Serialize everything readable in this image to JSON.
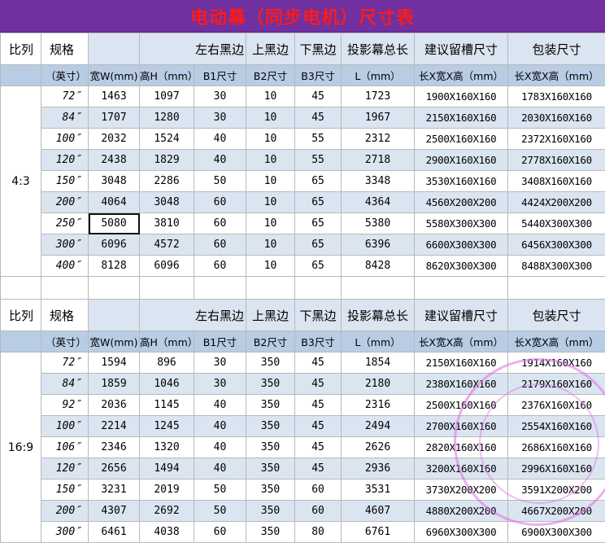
{
  "title": "电动幕（同步电机）尺寸表",
  "header_top": [
    "比列",
    "规格",
    "",
    "左右黑边",
    "上黑边",
    "下黑边",
    "投影幕总长",
    "建议留槽尺寸",
    "包装尺寸"
  ],
  "header_sub": [
    "",
    "（英寸）",
    "宽W(mm)",
    "高H（mm）",
    "B1尺寸",
    "B2尺寸",
    "B3尺寸",
    "L（mm）",
    "长X宽X高（mm）",
    "长X宽X高（mm）"
  ],
  "sections": [
    {
      "ratio": "4:3",
      "rows": [
        {
          "size": "72″",
          "w": "1463",
          "h": "1097",
          "b1": "30",
          "b2": "10",
          "b3": "45",
          "l": "1723",
          "slot": "1900X160X160",
          "pack": "1783X160X160"
        },
        {
          "size": "84″",
          "w": "1707",
          "h": "1280",
          "b1": "30",
          "b2": "10",
          "b3": "45",
          "l": "1967",
          "slot": "2150X160X160",
          "pack": "2030X160X160"
        },
        {
          "size": "100″",
          "w": "2032",
          "h": "1524",
          "b1": "40",
          "b2": "10",
          "b3": "55",
          "l": "2312",
          "slot": "2500X160X160",
          "pack": "2372X160X160"
        },
        {
          "size": "120″",
          "w": "2438",
          "h": "1829",
          "b1": "40",
          "b2": "10",
          "b3": "55",
          "l": "2718",
          "slot": "2900X160X160",
          "pack": "2778X160X160"
        },
        {
          "size": "150″",
          "w": "3048",
          "h": "2286",
          "b1": "50",
          "b2": "10",
          "b3": "65",
          "l": "3348",
          "slot": "3530X160X160",
          "pack": "3408X160X160"
        },
        {
          "size": "200″",
          "w": "4064",
          "h": "3048",
          "b1": "60",
          "b2": "10",
          "b3": "65",
          "l": "4364",
          "slot": "4560X200X200",
          "pack": "4424X200X200"
        },
        {
          "size": "250″",
          "w": "5080",
          "h": "3810",
          "b1": "60",
          "b2": "10",
          "b3": "65",
          "l": "5380",
          "slot": "5580X300X300",
          "pack": "5440X300X300"
        },
        {
          "size": "300″",
          "w": "6096",
          "h": "4572",
          "b1": "60",
          "b2": "10",
          "b3": "65",
          "l": "6396",
          "slot": "6600X300X300",
          "pack": "6456X300X300"
        },
        {
          "size": "400″",
          "w": "8128",
          "h": "6096",
          "b1": "60",
          "b2": "10",
          "b3": "65",
          "l": "8428",
          "slot": "8620X300X300",
          "pack": "8488X300X300"
        }
      ]
    },
    {
      "ratio": "16:9",
      "rows": [
        {
          "size": "72″",
          "w": "1594",
          "h": "896",
          "b1": "30",
          "b2": "350",
          "b3": "45",
          "l": "1854",
          "slot": "2150X160X160",
          "pack": "1914X160X160"
        },
        {
          "size": "84″",
          "w": "1859",
          "h": "1046",
          "b1": "30",
          "b2": "350",
          "b3": "45",
          "l": "2180",
          "slot": "2380X160X160",
          "pack": "2179X160X160"
        },
        {
          "size": "92″",
          "w": "2036",
          "h": "1145",
          "b1": "40",
          "b2": "350",
          "b3": "45",
          "l": "2316",
          "slot": "2500X160X160",
          "pack": "2376X160X160"
        },
        {
          "size": "100″",
          "w": "2214",
          "h": "1245",
          "b1": "40",
          "b2": "350",
          "b3": "45",
          "l": "2494",
          "slot": "2700X160X160",
          "pack": "2554X160X160"
        },
        {
          "size": "106″",
          "w": "2346",
          "h": "1320",
          "b1": "40",
          "b2": "350",
          "b3": "45",
          "l": "2626",
          "slot": "2820X160X160",
          "pack": "2686X160X160"
        },
        {
          "size": "120″",
          "w": "2656",
          "h": "1494",
          "b1": "40",
          "b2": "350",
          "b3": "45",
          "l": "2936",
          "slot": "3200X160X160",
          "pack": "2996X160X160"
        },
        {
          "size": "150″",
          "w": "3231",
          "h": "2019",
          "b1": "50",
          "b2": "350",
          "b3": "60",
          "l": "3531",
          "slot": "3730X200X200",
          "pack": "3591X200X200"
        },
        {
          "size": "200″",
          "w": "4307",
          "h": "2692",
          "b1": "50",
          "b2": "350",
          "b3": "60",
          "l": "4607",
          "slot": "4880X200X200",
          "pack": "4667X200X200"
        },
        {
          "size": "300″",
          "w": "6461",
          "h": "4038",
          "b1": "60",
          "b2": "350",
          "b3": "80",
          "l": "6761",
          "slot": "6960X300X300",
          "pack": "6900X300X300"
        }
      ]
    }
  ],
  "selected_cell": {
    "section": 0,
    "row": 6,
    "column": "w"
  }
}
